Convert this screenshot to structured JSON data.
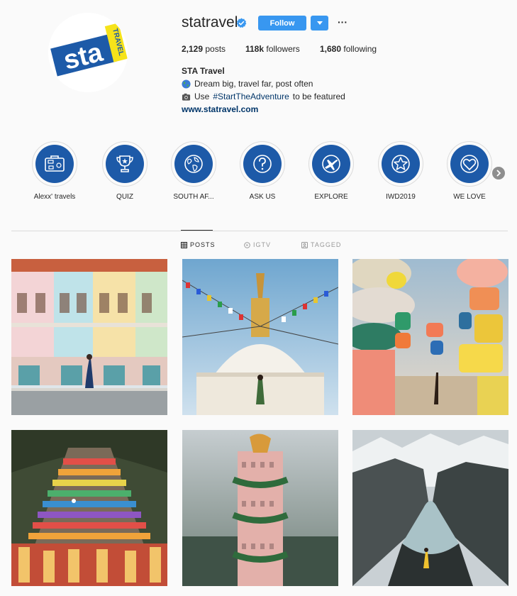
{
  "profile": {
    "username": "statravel",
    "follow_label": "Follow",
    "more_label": "···",
    "stats": {
      "posts_count": "2,129",
      "posts_label": "posts",
      "followers_count": "118k",
      "followers_label": "followers",
      "following_count": "1,680",
      "following_label": "following"
    },
    "full_name": "STA Travel",
    "bio_line1": "Dream big, travel far, post often",
    "bio_line2_prefix": "Use",
    "bio_hashtag": "#StartTheAdventure",
    "bio_line2_suffix": "to be featured",
    "website": "www.statravel.com",
    "logo_text": "sta",
    "logo_tag": "TRAVEL"
  },
  "highlights": [
    {
      "label": "Alexx' travels",
      "icon": "suitcase-icon"
    },
    {
      "label": "QUIZ",
      "icon": "trophy-icon"
    },
    {
      "label": "SOUTH AF...",
      "icon": "globe-icon"
    },
    {
      "label": "ASK US",
      "icon": "question-icon"
    },
    {
      "label": "EXPLORE",
      "icon": "airplane-icon"
    },
    {
      "label": "IWD2019",
      "icon": "star-icon"
    },
    {
      "label": "WE LOVE",
      "icon": "heart-icon"
    }
  ],
  "tabs": {
    "posts": "POSTS",
    "igtv": "IGTV",
    "tagged": "TAGGED"
  },
  "colors": {
    "accent": "#3897f0",
    "highlight_blue": "#1d5aa8",
    "link": "#003569"
  },
  "posts": [
    {
      "subject": "colorful shophouses"
    },
    {
      "subject": "stupa with prayer flags"
    },
    {
      "subject": "colorful rock towers"
    },
    {
      "subject": "rainbow temple stairs"
    },
    {
      "subject": "dragon tower"
    },
    {
      "subject": "mountain lake"
    }
  ]
}
